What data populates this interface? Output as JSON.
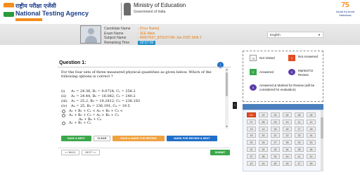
{
  "header": {
    "org_hindi": "राष्ट्रीय परीक्षा एजेंसी",
    "org_english": "National Testing Agency",
    "ministry_title": "Ministry of Education",
    "ministry_sub": "Government of India",
    "azadi_number": "75",
    "azadi_text": "Azadi Ka Amrit Mahotsav"
  },
  "candidate": {
    "labels": [
      "Candidate Name",
      "Exam Name",
      "Subject Name",
      "Remaining Time"
    ],
    "name": ": [Your Name]",
    "exam": ": JEE-Main",
    "subject": ": 4060?627_BTECH 5th Jan 2020 Shift 2",
    "remaining_time": "02:57:00"
  },
  "language": {
    "selected": "English"
  },
  "question": {
    "title": "Question 1:",
    "text": "For the four sets of three measured physical quantities as given below.   Which of the following options is correct ?",
    "options": [
      {
        "tag": "(i)",
        "text": "A₁ = 24.36, B₁ = 0.0724, C₁ = 256.2"
      },
      {
        "tag": "(ii)",
        "text": "A₂ = 24.44, B₂ = 16.082, C₂ = 240.2"
      },
      {
        "tag": "(iii)",
        "text": "A₃ = 25.2, B₃ = 19.2812, C₃ = 236.183"
      },
      {
        "tag": "(iv)",
        "text": "A₄ = 25, B₄ = 236.191, C₄ = 19.5"
      }
    ],
    "answers": [
      "A₁ + B₁ + C₁   <   A₃ + B₃ + C₃   <",
      "A₂ + B₂ + C₂ = A₃ + B₃ + C₃",
      "A₄ + B₄ + C₄",
      "A₁ + B₁ + C₁"
    ]
  },
  "actions": {
    "save_next": "SAVE & NEXT",
    "clear": "CLEAR",
    "save_mark": "SAVE & MARK FOR REVIEW",
    "mark_next": "MARK FOR REVIEW & NEXT",
    "back": "<< BACK",
    "next": "NEXT >>",
    "submit": "SUBMIT"
  },
  "legend": {
    "not_visited_count": "74",
    "not_visited": "Not Visited",
    "not_answered_count": "1",
    "not_answered": "Not Answered",
    "answered_count": "0",
    "answered": "Answered",
    "marked_count": "0",
    "marked": "Marked for Review",
    "answered_marked_count": "0",
    "answered_marked": "Answered & Marked for Review (will be considered for evaluation)"
  },
  "colors": {
    "orange": "#e87b10",
    "blue": "#1f6fc9",
    "green": "#3aa84a",
    "red": "#e34d22",
    "purple": "#5b3ca8"
  },
  "palette": {
    "questions": [
      "01",
      "02",
      "03",
      "04",
      "05",
      "06",
      "07",
      "08",
      "09",
      "10",
      "11",
      "12",
      "13",
      "14",
      "15",
      "16",
      "17",
      "18",
      "19",
      "20",
      "21",
      "22",
      "23",
      "24",
      "25",
      "26",
      "27",
      "28",
      "29",
      "30",
      "31",
      "32",
      "33",
      "34",
      "35",
      "36",
      "37",
      "38",
      "39",
      "40",
      "41",
      "42",
      "43",
      "44",
      "45",
      "46",
      "47",
      "48",
      "49",
      "50"
    ]
  }
}
